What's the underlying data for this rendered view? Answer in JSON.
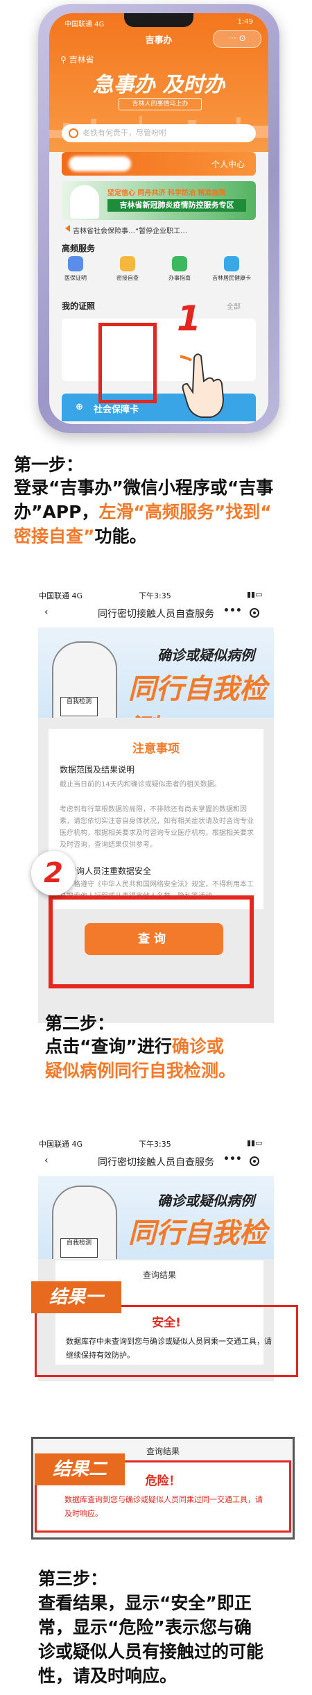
{
  "app": {
    "status_carrier": "中国联通 4G",
    "status_time": "下午3:35",
    "status_battery": "1:49",
    "nav_title": "吉事办",
    "capsule": "··· ⊙",
    "province": "吉林省",
    "slogan": "急事办 及时办",
    "sub_slogan": "吉林人的事情马上办",
    "search_placeholder": "老铁有何贵干，尽管吩咐",
    "user_center": "个人中心",
    "banner_line1": "坚定信心 同舟共济 科学防治 精准施策",
    "banner_line2": "吉林省新冠肺炎疫情防控服务专区",
    "notice": "吉林省社会保险事…“暂停企业职工…",
    "high_freq_title": "高频服务",
    "services": [
      {
        "label": "医保证明",
        "color": "#5a8de9"
      },
      {
        "label": "密接自查",
        "color": "#f5b73d"
      },
      {
        "label": "办事指南",
        "color": "#3cb95c"
      },
      {
        "label": "吉林居民健康卡",
        "color": "#38a8e8"
      }
    ],
    "my_section": "我的证照",
    "all_label": "全部",
    "bottom_card": "社会保障卡",
    "step_num": "1"
  },
  "step1": {
    "title": "第一步：",
    "line1": "登录“吉事办”微信小程序或“吉事",
    "line2_plain": "办”APP，",
    "line2_hl": "左滑“高频服务”找到“",
    "line3_hl": "密接自查”",
    "line3_plain": "功能。"
  },
  "screen2": {
    "status_carrier": "中国联通 4G",
    "status_time": "下午3:35",
    "nav_title": "同行密切接触人员自查服务",
    "poster_line1": "确诊或疑似病例",
    "poster_line2": "同行自我检测",
    "doctor_sign": "自我检测",
    "notice_title": "注意事项",
    "h1": "数据范围及结果说明",
    "p1": "截止当日前的14天内和确诊或疑似患者的相关数据。",
    "p2": "考虑到有行草根数据的局限，不排除还有尚未掌握的数据和因素，请您依切实注意自身体状况，如有相关症状请及时咨询专业医疗机构，根据相关要求及时咨询专业医疗机构，根据相关要求及时咨询，查询结果仅供参考。",
    "h2": "请查询人员注重数据安全",
    "p3": "请严格遵守《中华人民共和国网络安全法》规定，不得利用本工具搜索他人行程或从事得害他人名誉、隐私等活动。",
    "query_btn": "查询",
    "step_num": "2"
  },
  "step2": {
    "title": "第二步：",
    "line1_plain": "点击“查询”进行",
    "line1_hl": "确诊或",
    "line2_hl": "疑似病例同行自我检测。"
  },
  "screen3": {
    "status_carrier": "中国联通 4G",
    "status_time": "下午3:35",
    "nav_title": "同行密切接触人员自查服务",
    "poster_line1": "确诊或疑似病例",
    "poster_line2": "同行自我检测",
    "doctor_sign": "自我检测",
    "result1_tag": "结果一",
    "result1_sub": "查询结果",
    "result1_status": "安全!",
    "result1_text": "数据库存中未查询到您与确诊或疑似人员同乘一交通工具，请继续保持有效防护。",
    "result2_tag": "结果二",
    "result2_sub": "查询结果",
    "result2_status": "危险！",
    "result2_text": "数据库查询到您与确诊或疑似人员同乘过同一交通工具，请及时响应。"
  },
  "step3": {
    "title": "第三步：",
    "line1": "查看结果，显示“安全”即正",
    "line2": "常，显示“危险”表示您与确",
    "line3": "诊或疑似人员有接触过的可能",
    "line4": "性，请及时响应。"
  },
  "colors": {
    "accent": "#f37a2a",
    "red": "#e3271e",
    "green": "#1f8c3a"
  }
}
